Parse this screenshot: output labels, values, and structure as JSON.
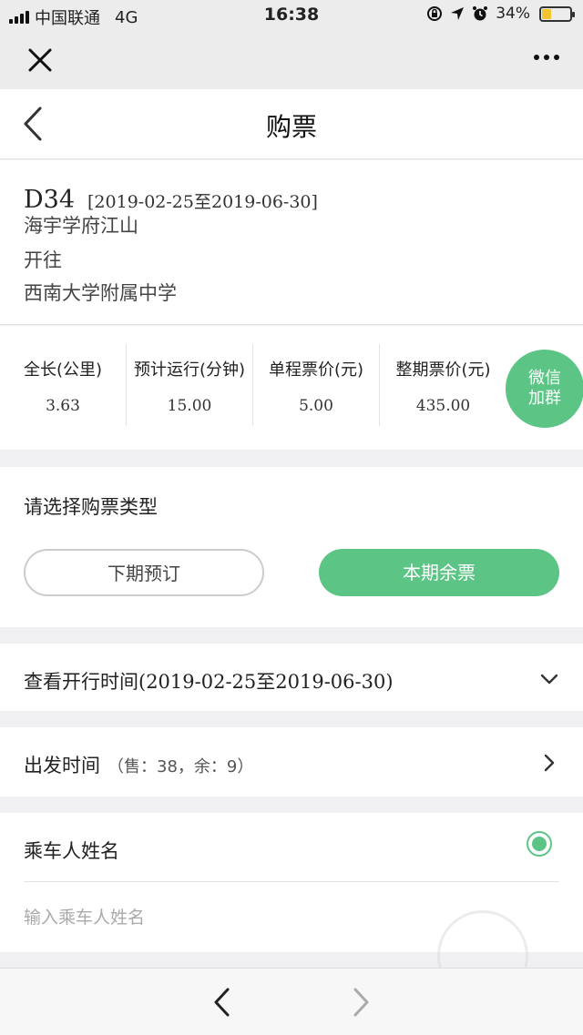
{
  "status_bar": {
    "carrier": "中国联通",
    "network": "4G",
    "time": "16:38",
    "battery": "34%",
    "battery_level": 0.34
  },
  "nav": {
    "title": "购票"
  },
  "route": {
    "code": "D34",
    "period": "[2019-02-25至2019-06-30]",
    "stops": [
      "海宇学府江山",
      "开往",
      "西南大学附属中学"
    ]
  },
  "stats": [
    {
      "label": "全长(公里)",
      "value": "3.63"
    },
    {
      "label": "预计运行(分钟)",
      "value": "15.00"
    },
    {
      "label": "单程票价(元)",
      "value": "5.00"
    },
    {
      "label": "整期票价(元)",
      "value": "435.00"
    }
  ],
  "wechat_fab": {
    "line1": "微信",
    "line2": "加群"
  },
  "ticket_type": {
    "label": "请选择购票类型",
    "options": [
      "下期预订",
      "本期余票"
    ],
    "selected": "本期余票"
  },
  "schedule": {
    "label_prefix": "查看开行时间",
    "label_dates": "(2019-02-25至2019-06-30)"
  },
  "departure": {
    "label": "出发时间",
    "detail": "（售：38，余：9）"
  },
  "passenger": {
    "label": "乘车人姓名",
    "placeholder": "输入乘车人姓名",
    "value": ""
  },
  "colors": {
    "accent": "#5cc585",
    "background": "#f0f0f2"
  }
}
